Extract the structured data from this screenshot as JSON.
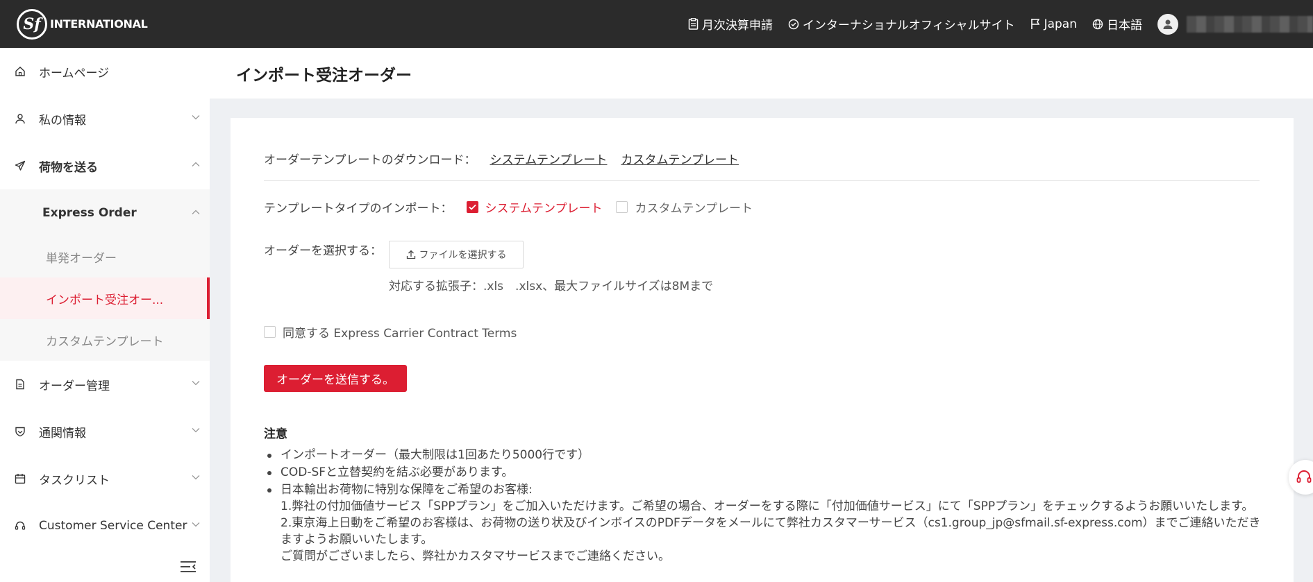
{
  "brand": {
    "logo_mark": "Sf",
    "name": "INTERNATIONAL"
  },
  "topnav": {
    "monthly": "月次決算申請",
    "intl_site": "インターナショナルオフィシャルサイト",
    "region": "Japan",
    "language": "日本語"
  },
  "sidebar": {
    "home": "ホームページ",
    "my_info": "私の情報",
    "send": "荷物を送る",
    "express_order": "Express Order",
    "single_order": "単発オーダー",
    "import_order": "インポート受注オー...",
    "custom_template": "カスタムテンプレート",
    "order_mgmt": "オーダー管理",
    "customs": "通関情報",
    "tasks": "タスクリスト",
    "cs_center": "Customer Service Center"
  },
  "page": {
    "title": "インポート受注オーダー"
  },
  "form": {
    "download_label": "オーダーテンプレートのダウンロード：",
    "download_system": "システムテンプレート",
    "download_custom": "カスタムテンプレート",
    "type_label": "テンプレートタイプのインポート：",
    "type_system": "システムテンプレート",
    "type_custom": "カスタムテンプレート",
    "type_system_checked": true,
    "type_custom_checked": false,
    "select_label": "オーダーを選択する：",
    "file_button": "ファイルを選択する",
    "file_hint": "対応する拡張子：.xls　.xlsx、最大ファイルサイズは8Mまで",
    "agree_label": "同意する Express Carrier Contract Terms",
    "agree_checked": false,
    "submit": "オーダーを送信する。"
  },
  "notes": {
    "title": "注意",
    "item1": "インポートオーダー（最大制限は1回あたり5000行です）",
    "item2": "COD-SFと立替契約を結ぶ必要があります。",
    "item3_line1": "日本輸出お荷物に特別な保障をご希望のお客様:",
    "item3_line2": "1.弊社の付加価値サービス「SPPプラン」をご加入いただけます。ご希望の場合、オーダーをする際に「付加価値サービス」にて「SPPプラン」をチェックするようお願いいたします。",
    "item3_line3": "2.東京海上日動をご希望のお客様は、お荷物の送り状及びインボイスのPDFデータをメールにて弊社カスタマーサービス（cs1.group_jp@sfmail.sf-express.com）までご連絡いただきますようお願いいたします。",
    "item3_line4": "ご質問がございましたら、弊社かカスタマサービスまでご連絡ください。"
  },
  "colors": {
    "brand_red": "#dc1e32",
    "topbar": "#2b2b2b"
  }
}
